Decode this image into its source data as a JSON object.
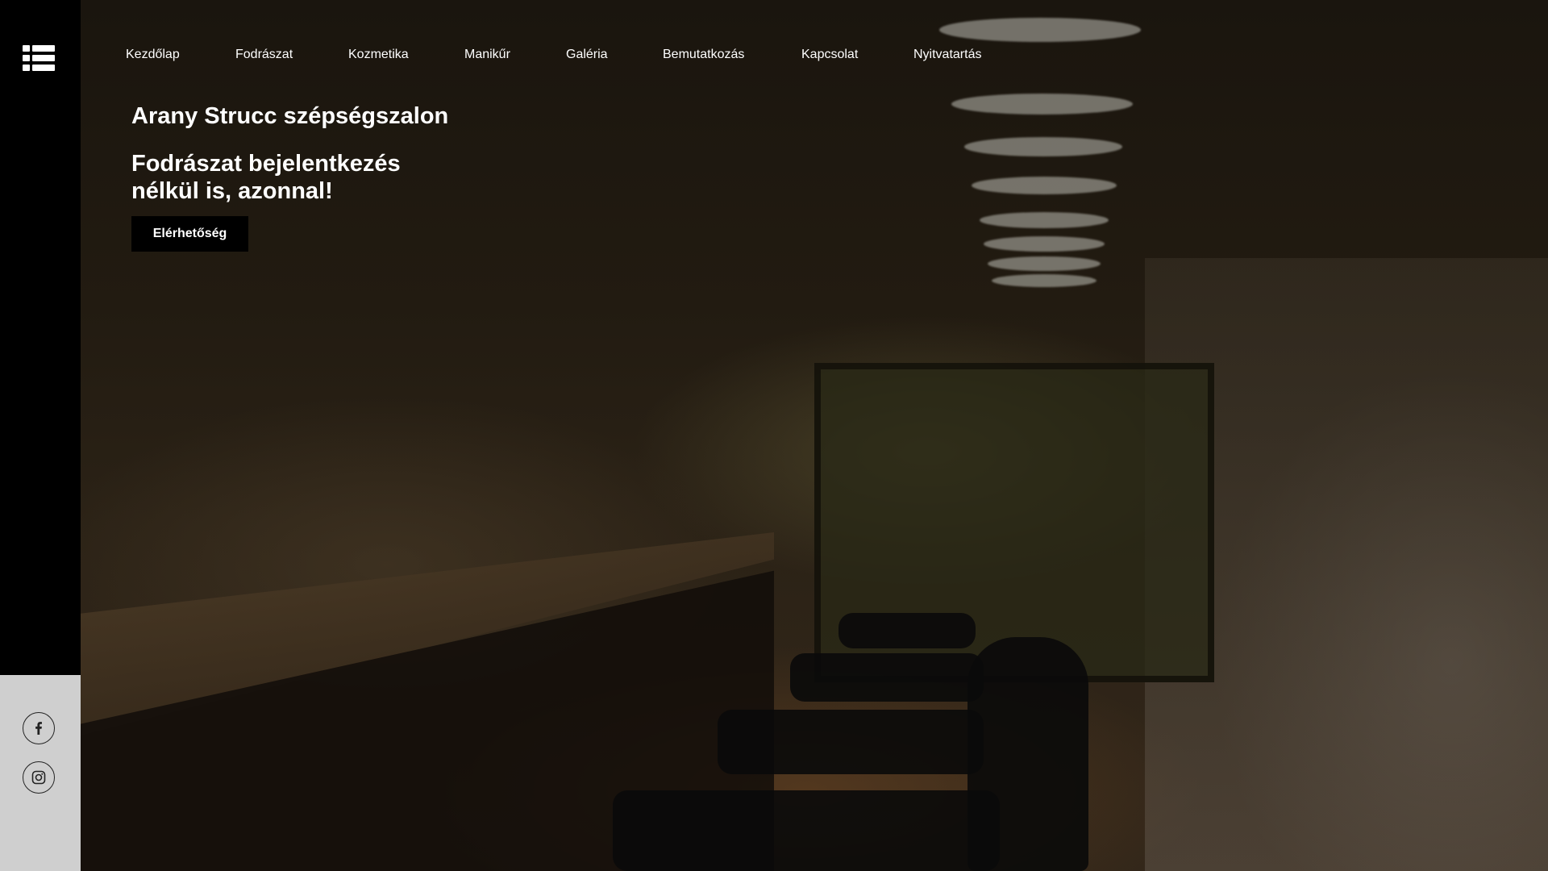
{
  "nav": {
    "items": [
      {
        "label": "Kezdőlap"
      },
      {
        "label": "Fodrászat"
      },
      {
        "label": "Kozmetika"
      },
      {
        "label": "Manikűr"
      },
      {
        "label": "Galéria"
      },
      {
        "label": "Bemutatkozás"
      },
      {
        "label": "Kapcsolat"
      },
      {
        "label": "Nyitvatartás"
      }
    ]
  },
  "hero": {
    "brand": "Arany Strucc szépségszalon",
    "tagline": "Fodrászat bejelentkezés nélkül is, azonnal!",
    "cta_label": "Elérhetőség"
  },
  "sidebar": {
    "menu_icon": "list-menu-icon",
    "social": [
      {
        "icon": "facebook-icon"
      },
      {
        "icon": "instagram-icon"
      }
    ]
  },
  "colors": {
    "sidebar_bg": "#000000",
    "social_panel_bg": "#cfcfcf",
    "cta_bg": "#000000",
    "text": "#ffffff"
  }
}
